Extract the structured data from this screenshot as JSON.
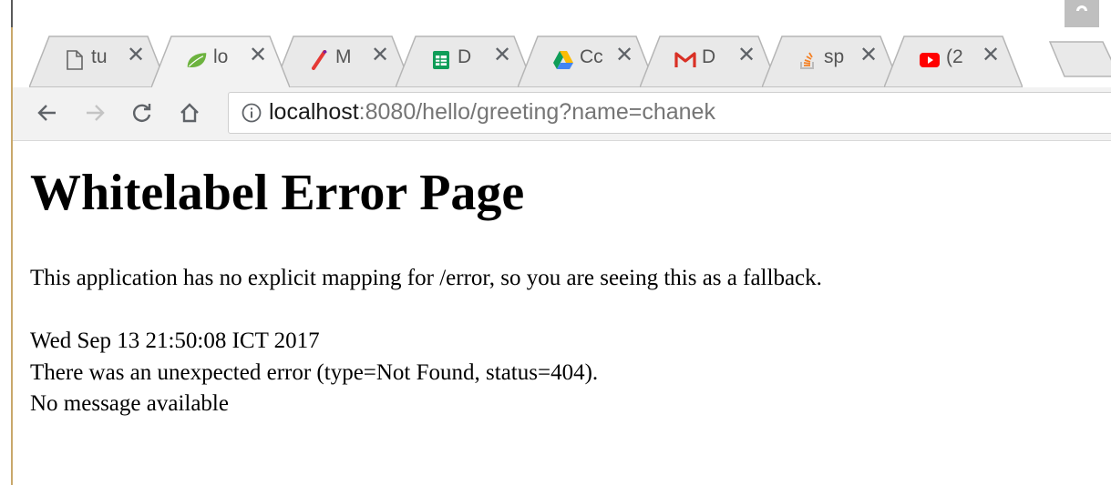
{
  "browser": {
    "tabs": [
      {
        "title": "tu",
        "icon": "page-icon"
      },
      {
        "title": "lo",
        "icon": "spring-leaf-icon",
        "active": true
      },
      {
        "title": "M",
        "icon": "pen-icon"
      },
      {
        "title": "D",
        "icon": "sheets-icon"
      },
      {
        "title": "Cc",
        "icon": "drive-icon"
      },
      {
        "title": "D",
        "icon": "gmail-icon"
      },
      {
        "title": "sp",
        "icon": "stackoverflow-icon"
      },
      {
        "title": "(2",
        "icon": "youtube-icon"
      }
    ],
    "close_glyph": "✕",
    "address": {
      "host": "localhost",
      "rest": ":8080/hello/greeting?name=chanek"
    }
  },
  "page": {
    "heading": "Whitelabel Error Page",
    "explanation": "This application has no explicit mapping for /error, so you are seeing this as a fallback.",
    "timestamp": "Wed Sep 13 21:50:08 ICT 2017",
    "error_line": "There was an unexpected error (type=Not Found, status=404).",
    "message": "No message available"
  },
  "colors": {
    "toolbar_bg": "#f2f2f2",
    "tab_inactive": "#e9e9e9",
    "tab_active": "#f2f2f2",
    "sheets_green": "#0f9d58",
    "gmail_red": "#d93025",
    "youtube_red": "#ff0000",
    "spring_green": "#6db33f"
  }
}
